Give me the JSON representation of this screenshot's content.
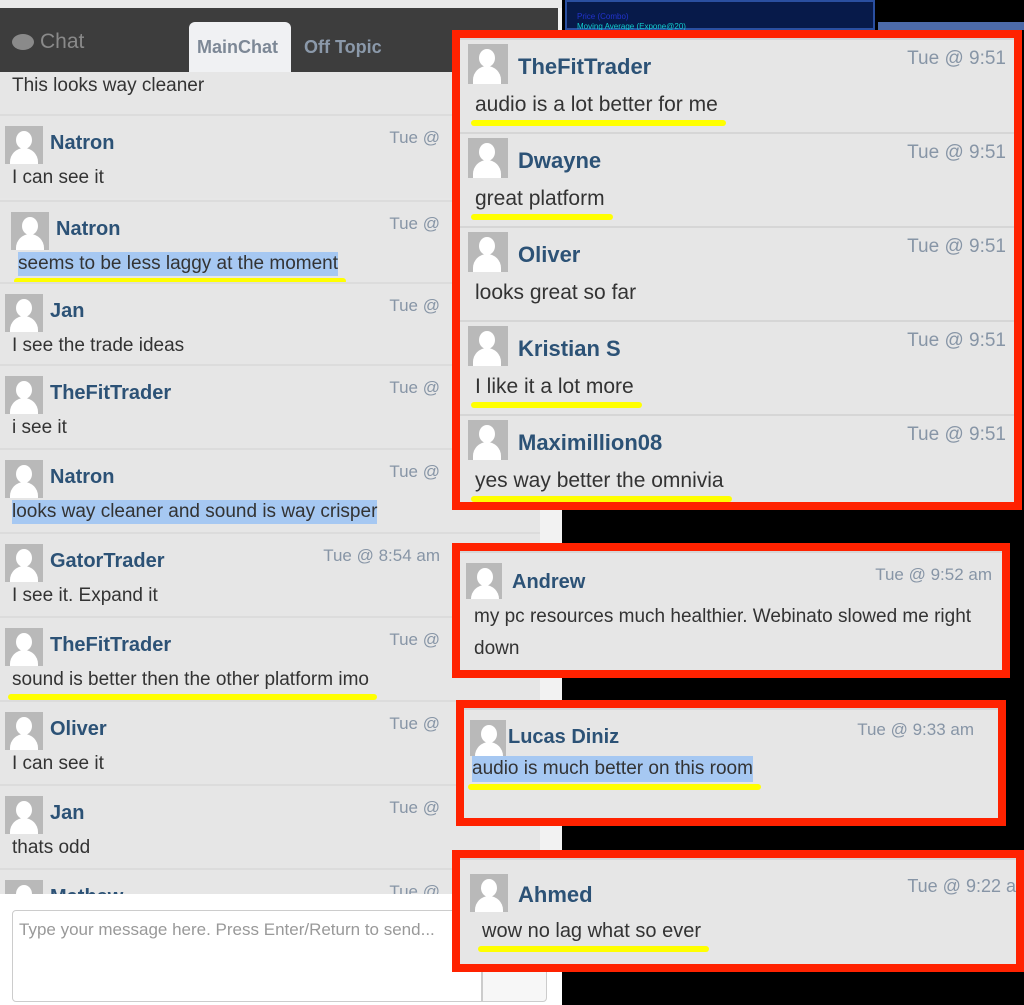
{
  "header": {
    "chat_label": "Chat",
    "tabs": [
      {
        "label": "MainChat",
        "active": true
      },
      {
        "label": "Off Topic",
        "active": false
      }
    ]
  },
  "background_chart": {
    "legend": [
      "Price (Combo)",
      "Moving Average (Expone@20)"
    ]
  },
  "left_messages": [
    {
      "name": "",
      "time": "",
      "text": "This looks way cleaner"
    },
    {
      "name": "Natron",
      "time": "Tue @",
      "text": "I can see it"
    },
    {
      "name": "Natron",
      "time": "Tue @",
      "text": "seems to be less laggy at the moment",
      "highlight": true,
      "underline": true
    },
    {
      "name": "Jan",
      "time": "Tue @",
      "text": "I see the trade ideas"
    },
    {
      "name": "TheFitTrader",
      "time": "Tue @",
      "text": "i see it"
    },
    {
      "name": "Natron",
      "time": "Tue @",
      "text": "looks way cleaner and sound is way crisper",
      "highlight": true
    },
    {
      "name": "GatorTrader",
      "time": "Tue @ 8:54 am",
      "text": "I see it. Expand it"
    },
    {
      "name": "TheFitTrader",
      "time": "Tue @",
      "text": "sound is better then the other platform imo",
      "underline": true
    },
    {
      "name": "Oliver",
      "time": "Tue @",
      "text": "I can see it"
    },
    {
      "name": "Jan",
      "time": "Tue @",
      "text": "thats odd"
    },
    {
      "name": "Mathew",
      "time": "Tue @",
      "text": ""
    }
  ],
  "input": {
    "placeholder": "Type your message here. Press Enter/Return to send..."
  },
  "highlight_boxes": [
    {
      "messages": [
        {
          "name": "TheFitTrader",
          "time": "Tue @ 9:51",
          "text": "audio is a lot better for me",
          "underline": true
        },
        {
          "name": "Dwayne",
          "time": "Tue @ 9:51",
          "text": "great platform",
          "underline": true
        },
        {
          "name": "Oliver",
          "time": "Tue @ 9:51",
          "text": "looks great so far"
        },
        {
          "name": "Kristian S",
          "time": "Tue @ 9:51",
          "text": "I like it a lot more",
          "underline": true
        },
        {
          "name": "Maximillion08",
          "time": "Tue @ 9:51",
          "text": "yes way better the omnivia",
          "underline": true
        }
      ]
    },
    {
      "messages": [
        {
          "name": "Andrew",
          "time": "Tue @ 9:52 am",
          "text": "my pc resources much healthier. Webinato slowed me right down"
        }
      ]
    },
    {
      "messages": [
        {
          "name": "Lucas Diniz",
          "time": "Tue @ 9:33 am",
          "text": "audio is much better on this room",
          "highlight": true,
          "underline": true
        }
      ]
    },
    {
      "messages": [
        {
          "name": "Ahmed",
          "time": "Tue @ 9:22 a",
          "text": "wow no lag what so ever",
          "underline": true
        }
      ]
    }
  ],
  "colors": {
    "annotation_box": "#ff2200",
    "underline": "#ffff00",
    "selection": "#a6c8f2",
    "username": "#2c5276"
  }
}
